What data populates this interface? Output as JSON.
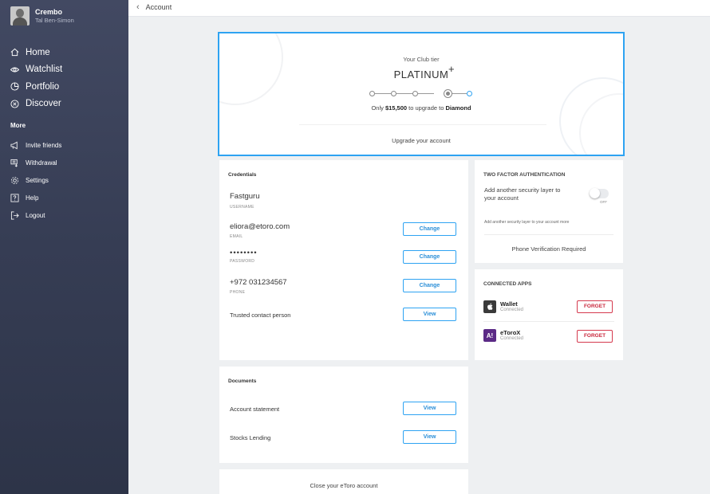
{
  "profile": {
    "name": "Crembo",
    "subtitle": "Tal Ben-Simon"
  },
  "nav": {
    "main": [
      {
        "label": "Home",
        "icon": "home-icon"
      },
      {
        "label": "Watchlist",
        "icon": "eye-icon"
      },
      {
        "label": "Portfolio",
        "icon": "pie-chart-icon"
      },
      {
        "label": "Discover",
        "icon": "compass-icon"
      }
    ],
    "more_title": "More",
    "sub": [
      {
        "label": "Invite friends",
        "icon": "megaphone-icon"
      },
      {
        "label": "Withdrawal",
        "icon": "withdrawal-icon"
      },
      {
        "label": "Settings",
        "icon": "gear-icon"
      },
      {
        "label": "Help",
        "icon": "help-icon"
      },
      {
        "label": "Logout",
        "icon": "logout-icon"
      }
    ]
  },
  "topbar": {
    "back_label": "Account"
  },
  "club": {
    "label": "Your Club tier",
    "tier": "PLATINUM",
    "plus": "+",
    "tier_count": 5,
    "current_tier_index": 3,
    "upgrade_prefix": "Only",
    "upgrade_amount": "$15,500",
    "upgrade_mid": "to upgrade to",
    "upgrade_target": "Diamond",
    "upgrade_link": "Upgrade your account"
  },
  "credentials": {
    "title": "Credentials",
    "username": {
      "value": "Fastguru",
      "label": "USERNAME"
    },
    "email": {
      "value": "eliora@etoro.com",
      "label": "EMAIL",
      "button": "Change"
    },
    "password": {
      "value": "••••••••",
      "label": "PASSWORD",
      "button": "Change"
    },
    "phone": {
      "value": "+972 031234567",
      "label": "PHONE",
      "button": "Change"
    },
    "trusted": {
      "value": "Trusted contact person",
      "button": "View"
    }
  },
  "tfa": {
    "title": "TWO FACTOR AUTHENTICATION",
    "description": "Add another security layer to your account",
    "toggle_state": "OFF",
    "more": "Add another security layer to your account more",
    "phone": "Phone Verification Required"
  },
  "apps": {
    "title": "CONNECTED APPS",
    "items": [
      {
        "name": "Wallet",
        "status": "Connected",
        "button": "FORGET",
        "icon": "apple-icon",
        "color": "#3a3a3a"
      },
      {
        "name": "eToroX",
        "status": "Connected",
        "button": "FORGET",
        "icon": "etorox-icon",
        "glyph": "A!",
        "color": "#5b2a86"
      }
    ]
  },
  "documents": {
    "title": "Documents",
    "items": [
      {
        "label": "Account statement",
        "button": "View"
      },
      {
        "label": "Stocks Lending",
        "button": "View"
      }
    ]
  },
  "close_account": {
    "label": "Close your eToro account"
  },
  "colors": {
    "accent": "#2ea3f2",
    "danger": "#d53a4e",
    "sidebar": "#3a4158"
  }
}
